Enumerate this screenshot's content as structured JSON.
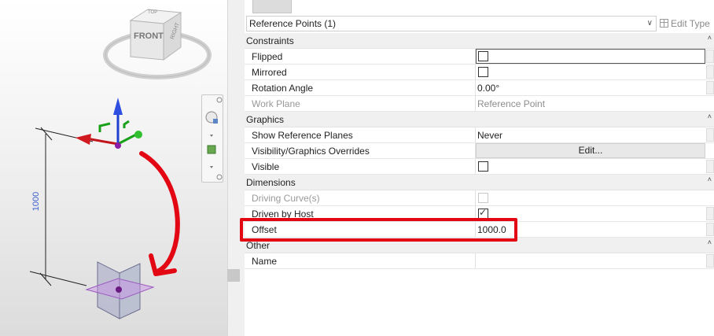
{
  "viewcube": {
    "front": "FRONT",
    "top": "TOP",
    "right": "RIGHT"
  },
  "dimension": {
    "label": "1000"
  },
  "properties": {
    "type_selector": "Reference Points (1)",
    "edit_type": "Edit Type",
    "groups": [
      {
        "name": "Constraints",
        "rows": [
          {
            "label": "Flipped",
            "value": "",
            "kind": "checkbox",
            "checked": false
          },
          {
            "label": "Mirrored",
            "value": "",
            "kind": "checkbox",
            "checked": false
          },
          {
            "label": "Rotation Angle",
            "value": "0.00°",
            "kind": "text"
          },
          {
            "label": "Work Plane",
            "value": "Reference Point",
            "kind": "text",
            "disabled": true
          }
        ]
      },
      {
        "name": "Graphics",
        "rows": [
          {
            "label": "Show Reference Planes",
            "value": "Never",
            "kind": "text"
          },
          {
            "label": "Visibility/Graphics Overrides",
            "value": "Edit...",
            "kind": "button"
          },
          {
            "label": "Visible",
            "value": "",
            "kind": "checkbox",
            "checked": false
          }
        ]
      },
      {
        "name": "Dimensions",
        "rows": [
          {
            "label": "Driving Curve(s)",
            "value": "",
            "kind": "checkbox",
            "checked": false,
            "disabled": true
          },
          {
            "label": "Driven by Host",
            "value": "",
            "kind": "checkbox",
            "checked": true
          },
          {
            "label": "Offset",
            "value": "1000.0",
            "kind": "text"
          }
        ]
      },
      {
        "name": "Other",
        "rows": [
          {
            "label": "Name",
            "value": "",
            "kind": "text"
          }
        ]
      }
    ]
  },
  "colors": {
    "highlight": "#e30613",
    "annotation_arrow": "#e30613",
    "dimension_text": "#3a5fcd"
  }
}
